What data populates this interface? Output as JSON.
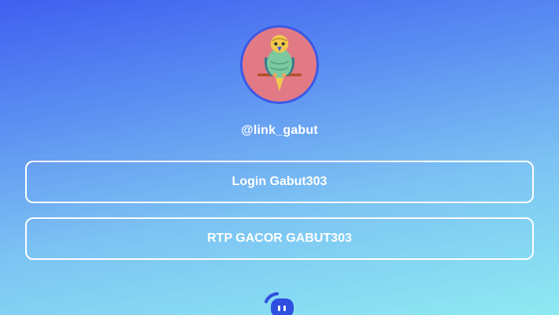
{
  "profile": {
    "avatar_icon": "parrot-avatar",
    "username": "@link_gabut"
  },
  "links": [
    {
      "label": "Login Gabut303"
    },
    {
      "label": "RTP GACOR GABUT303"
    }
  ],
  "footer": {
    "logo_icon": "linktree-bot-logo"
  },
  "colors": {
    "avatar_border": "#3a59e6",
    "avatar_bg": "#e27a86",
    "gradient_top": "#3f5ff0",
    "gradient_bottom": "#8eeaf2",
    "button_border": "#ffffff",
    "text": "#ffffff"
  }
}
